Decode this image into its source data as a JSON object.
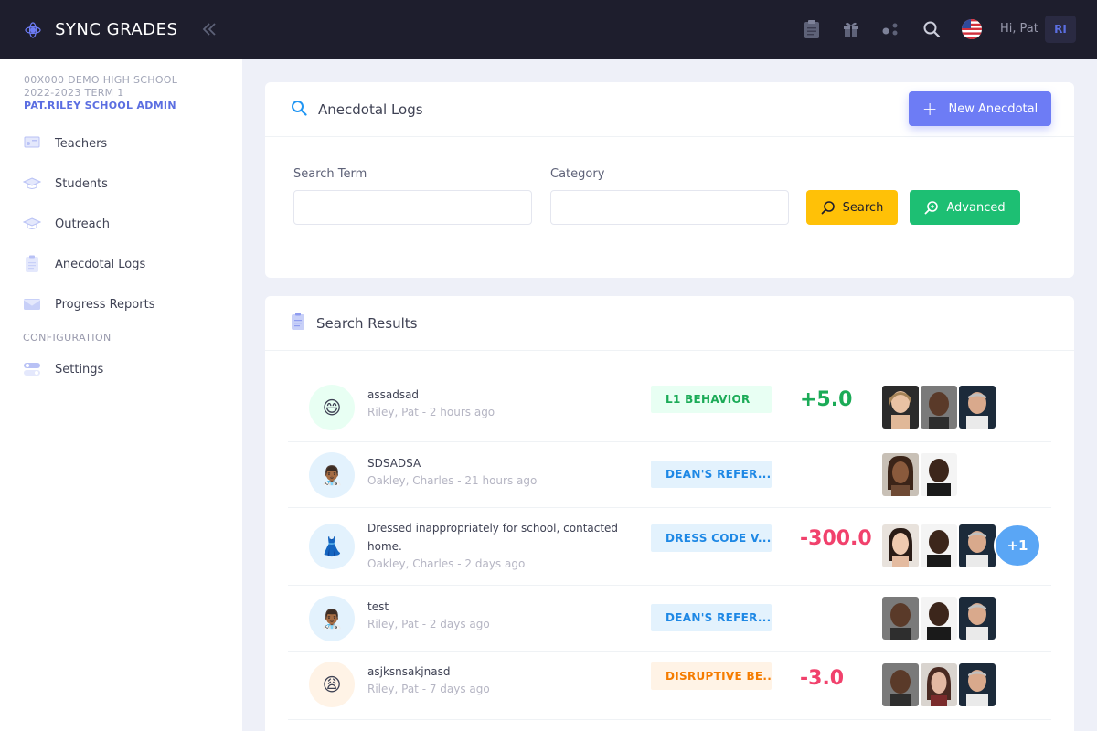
{
  "brand": {
    "name": "SYNC GRADES"
  },
  "school": {
    "line1": "00X000 DEMO HIGH SCHOOL",
    "line2": "2022-2023 TERM 1",
    "line3": "PAT.RILEY SCHOOL ADMIN"
  },
  "sidebar": {
    "items": [
      {
        "label": "Teachers",
        "icon": "teacher-icon"
      },
      {
        "label": "Students",
        "icon": "graduation-cap-icon"
      },
      {
        "label": "Outreach",
        "icon": "graduation-cap-icon"
      },
      {
        "label": "Anecdotal Logs",
        "icon": "clipboard-icon"
      },
      {
        "label": "Progress Reports",
        "icon": "envelope-icon"
      }
    ],
    "section": "CONFIGURATION",
    "settings_label": "Settings"
  },
  "topbar": {
    "greeting": "Hi,",
    "user_name": "Pat",
    "initials": "RI",
    "icons": [
      "clipboard-icon",
      "gift-icon",
      "apps-icon",
      "search-icon",
      "us-flag-icon"
    ]
  },
  "search_card": {
    "title": "Anecdotal Logs",
    "new_button": "New Anecdotal",
    "term_label": "Search Term",
    "term_value": "",
    "category_label": "Category",
    "category_value": "",
    "search_button": "Search",
    "advanced_button": "Advanced"
  },
  "results_card": {
    "title": "Search Results",
    "rows": [
      {
        "title": "assadsad",
        "meta": "Riley, Pat - 2 hours ago",
        "badge": "L1 BEHAVIOR",
        "badge_color": "green",
        "points": "+5.0",
        "emoji": "😄",
        "faces": 3,
        "more": ""
      },
      {
        "title": "SDSADSA",
        "meta": "Oakley, Charles - 21 hours ago",
        "badge": "DEAN'S REFER...",
        "badge_color": "blue",
        "points": "",
        "emoji": "👨🏾‍⚕️",
        "faces": 2,
        "more": ""
      },
      {
        "title": "Dressed inappropriately for school, contacted home.",
        "meta": "Oakley, Charles - 2 days ago",
        "badge": "DRESS CODE V...",
        "badge_color": "blue",
        "points": "-300.0",
        "emoji": "👗",
        "faces": 3,
        "more": "+1"
      },
      {
        "title": "test",
        "meta": "Riley, Pat - 2 days ago",
        "badge": "DEAN'S REFER...",
        "badge_color": "blue",
        "points": "",
        "emoji": "👨🏾‍⚕️",
        "faces": 3,
        "more": ""
      },
      {
        "title": "asjksnsakjnasd",
        "meta": "Riley, Pat - 7 days ago",
        "badge": "DISRUPTIVE BE...",
        "badge_color": "orange",
        "points": "-3.0",
        "emoji": "😩",
        "faces": 3,
        "more": ""
      }
    ]
  },
  "colors": {
    "dark": "#1e1e2d",
    "primary": "#6d7cf5",
    "warning": "#ffc107",
    "success": "#1dbf73",
    "danger": "#f1416c"
  }
}
